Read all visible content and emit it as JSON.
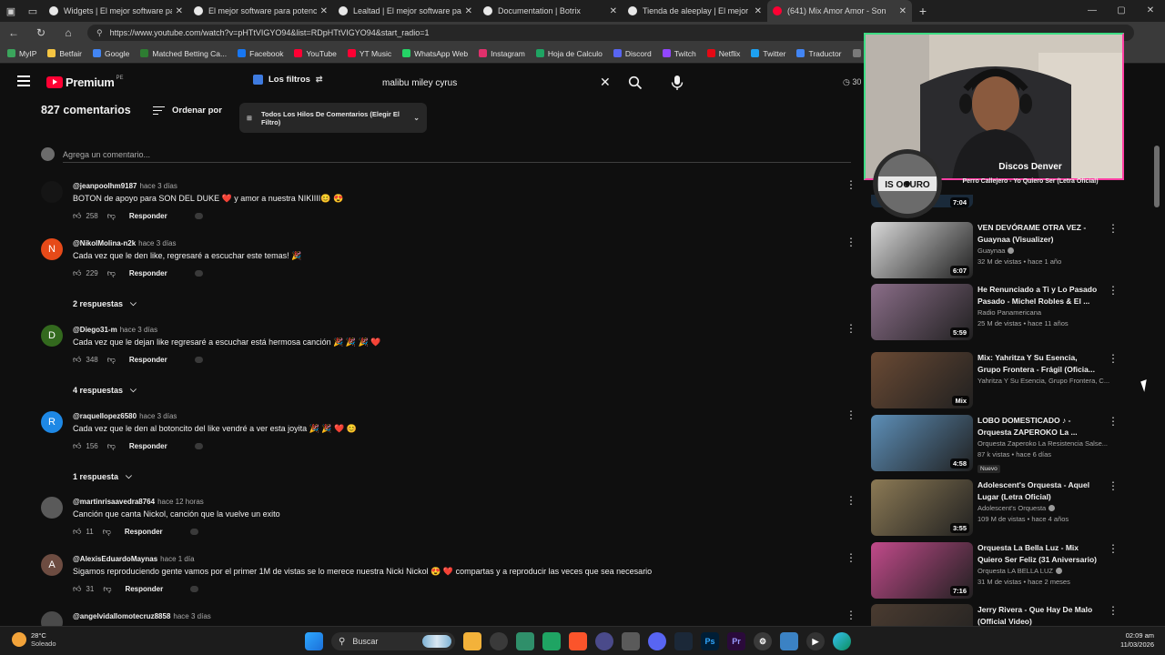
{
  "browser": {
    "tabs": [
      {
        "title": "Widgets | El mejor software para p",
        "active": false
      },
      {
        "title": "El mejor software para potenciar",
        "active": false
      },
      {
        "title": "Lealtad | El mejor software para p",
        "active": false
      },
      {
        "title": "Documentation | Botrix",
        "active": false
      },
      {
        "title": "Tienda de aleeplay | El mejor soft",
        "active": false
      },
      {
        "title": "(641) Mix Amor Amor - Son",
        "active": true
      }
    ],
    "url": "https://www.youtube.com/watch?v=pHTtVIGYO94&list=RDpHTtVIGYO94&start_radio=1",
    "bookmarks": [
      {
        "label": "MyIP",
        "color": "#3ba55c"
      },
      {
        "label": "Betfair",
        "color": "#f5c542"
      },
      {
        "label": "Google",
        "color": "#4285f4"
      },
      {
        "label": "Matched Betting Ca...",
        "color": "#2e7d32"
      },
      {
        "label": "Facebook",
        "color": "#1877f2"
      },
      {
        "label": "YouTube",
        "color": "#ff0033"
      },
      {
        "label": "YT Music",
        "color": "#ff0033"
      },
      {
        "label": "WhatsApp Web",
        "color": "#25d366"
      },
      {
        "label": "Instagram",
        "color": "#e1306c"
      },
      {
        "label": "Hoja de Calculo",
        "color": "#1fa463"
      },
      {
        "label": "Discord",
        "color": "#5865f2"
      },
      {
        "label": "Twitch",
        "color": "#9146ff"
      },
      {
        "label": "Netflix",
        "color": "#e50914"
      },
      {
        "label": "Twitter",
        "color": "#1da1f2"
      },
      {
        "label": "Traductor",
        "color": "#4285f4"
      },
      {
        "label": "Cinepl",
        "color": "#7a7a7a"
      }
    ]
  },
  "header": {
    "logo_text": "Premium",
    "logo_country": "PE",
    "filters_label": "Los filtros",
    "search_value": "malibu miley cyrus",
    "right_text": "30"
  },
  "comments": {
    "count_label": "827 comentarios",
    "sort_label": "Ordenar por",
    "thread_filter": "Todos Los Hilos De Comentarios (Elegir El Filtro)",
    "add_placeholder": "Agrega un comentario...",
    "reply_label": "Responder",
    "items": [
      {
        "user": "@jeanpoolhm9187",
        "time": "hace 3 días",
        "text": "BOTON de apoyo para SON DEL DUKE ❤️ y amor a nuestra NIKIIII😊 😍",
        "likes": "258",
        "avatar_letter": "",
        "avatar_color": "#151515",
        "replies": ""
      },
      {
        "user": "@NikolMolina-n2k",
        "time": "hace 3 días",
        "text": "Cada vez que le den like, regresaré a escuchar este temas! 🎉",
        "likes": "229",
        "avatar_letter": "N",
        "avatar_color": "#e64a19",
        "replies": "2 respuestas"
      },
      {
        "user": "@Diego31-m",
        "time": "hace 3 días",
        "text": "Cada vez que le dejan like regresaré a escuchar está hermosa canción 🎉 🎉 🎉 ❤️",
        "likes": "348",
        "avatar_letter": "D",
        "avatar_color": "#33691e",
        "replies": "4 respuestas"
      },
      {
        "user": "@raquellopez6580",
        "time": "hace 3 días",
        "text": "Cada vez que le den al botoncito del like vendré a ver  esta joyita 🎉 🎉 ❤️ 😊",
        "likes": "156",
        "avatar_letter": "R",
        "avatar_color": "#1e88e5",
        "replies": "1 respuesta"
      },
      {
        "user": "@martinrisaavedra8764",
        "time": "hace 12 horas",
        "text": "Canción que canta Nickol, canción que la vuelve un exito",
        "likes": "11",
        "avatar_letter": "",
        "avatar_color": "#5a5a5a",
        "replies": ""
      },
      {
        "user": "@AlexisEduardoMaynas",
        "time": "hace 1 día",
        "text": "Sigamos reproduciendo gente vamos por el primer 1M de vistas se lo merece nuestra Nicki Nickol 😍 ❤️  compartas y a reproducir las veces que sea necesario",
        "likes": "31",
        "avatar_letter": "A",
        "avatar_color": "#6d4c41",
        "replies": ""
      },
      {
        "user": "@angelvidallomotecruz8858",
        "time": "hace 3 días",
        "text": "",
        "likes": "",
        "avatar_letter": "",
        "avatar_color": "#4a4a4a",
        "replies": ""
      }
    ]
  },
  "sidebar": {
    "first_duration": "7:04",
    "items": [
      {
        "title": "VEN DEVÓRAME OTRA VEZ - Guaynaa (Visualizer)",
        "channel": "Guaynaa",
        "verified": true,
        "stats": "32 M de vistas • hace 1 año",
        "duration": "6:07",
        "badge": "",
        "thumb": "#d8d8d8"
      },
      {
        "title": "He Renunciado a Ti y Lo Pasado Pasado - Michel Robles & El ...",
        "channel": "Radio Panamericana",
        "verified": false,
        "stats": "25 M de vistas • hace 11 años",
        "duration": "5:59",
        "badge": "",
        "thumb": "#8a6d88"
      },
      {
        "title": "Mix: Yahritza Y Su Esencia, Grupo Frontera - Frágil (Oficia...",
        "channel": "Yahritza Y Su Esencia, Grupo Frontera, C...",
        "verified": false,
        "stats": "",
        "duration": "Mix",
        "badge": "",
        "thumb": "#6a4a34"
      },
      {
        "title": "LOBO DOMESTICADO ♪ - Orquesta ZAPEROKO La ...",
        "channel": "Orquesta Zaperoko La Resistencia Salse...",
        "verified": false,
        "stats": "87 k vistas • hace 6 días",
        "duration": "4:58",
        "badge": "Nuevo",
        "thumb": "#5d8fb8"
      },
      {
        "title": "Adolescent's Orquesta - Aquel Lugar (Letra Oficial)",
        "channel": "Adolescent's Orquesta",
        "verified": true,
        "stats": "109 M de vistas • hace 4 años",
        "duration": "3:55",
        "badge": "",
        "thumb": "#8c7a55"
      },
      {
        "title": "Orquesta La Bella Luz - Mix Quiero Ser Feliz (31 Aniversario)",
        "channel": "Orquesta LA BELLA LUZ",
        "verified": true,
        "stats": "31 M de vistas • hace 2 meses",
        "duration": "7:16",
        "badge": "",
        "thumb": "#c14a8a"
      },
      {
        "title": "Jerry Rivera - Que Hay De Malo (Official Video)",
        "channel": "",
        "verified": false,
        "stats": "",
        "duration": "",
        "badge": "",
        "thumb": "#4a3b30"
      }
    ]
  },
  "overlay": {
    "artist": "Discos Denver",
    "track": "Perro Callejero - Yo Quiero Ser (Letra Oficial)",
    "disc_text": "IS OCURO"
  },
  "taskbar": {
    "temp": "28°C",
    "weather": "Soleado",
    "search_label": "Buscar",
    "time": "02:09 am",
    "date": "11/03/2026"
  },
  "colors": {
    "accent_red": "#ff0033",
    "background": "#0f0f0f"
  }
}
